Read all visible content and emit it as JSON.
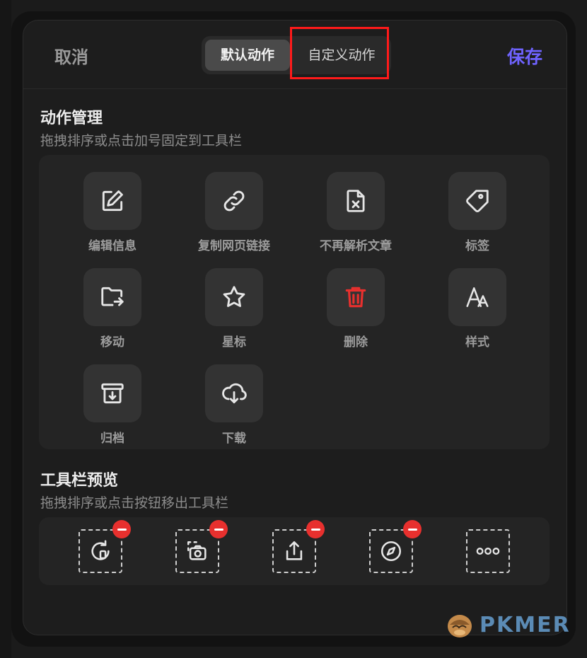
{
  "header": {
    "cancel_label": "取消",
    "save_label": "保存",
    "tabs": [
      {
        "label": "默认动作",
        "active": true
      },
      {
        "label": "自定义动作",
        "active": false
      }
    ]
  },
  "action_section": {
    "title": "动作管理",
    "subtitle": "拖拽排序或点击加号固定到工具栏",
    "actions": [
      {
        "label": "编辑信息",
        "icon": "edit-icon"
      },
      {
        "label": "复制网页链接",
        "icon": "link-icon"
      },
      {
        "label": "不再解析文章",
        "icon": "file-x-icon"
      },
      {
        "label": "标签",
        "icon": "tag-icon"
      },
      {
        "label": "移动",
        "icon": "folder-move-icon"
      },
      {
        "label": "星标",
        "icon": "star-icon"
      },
      {
        "label": "删除",
        "icon": "trash-icon"
      },
      {
        "label": "样式",
        "icon": "text-style-icon"
      },
      {
        "label": "归档",
        "icon": "archive-icon"
      },
      {
        "label": "下载",
        "icon": "cloud-download-icon"
      }
    ]
  },
  "toolbar_section": {
    "title": "工具栏预览",
    "subtitle": "拖拽排序或点击按钮移出工具栏",
    "tools": [
      {
        "icon": "refresh-clip-icon"
      },
      {
        "icon": "screenshot-camera-icon"
      },
      {
        "icon": "share-icon"
      },
      {
        "icon": "compass-icon"
      },
      {
        "icon": "more-icon"
      }
    ]
  },
  "brand": {
    "text": "PKMER"
  },
  "colors": {
    "accent": "#6f63ff",
    "danger": "#e8302e",
    "highlight": "#ff1a1a"
  }
}
